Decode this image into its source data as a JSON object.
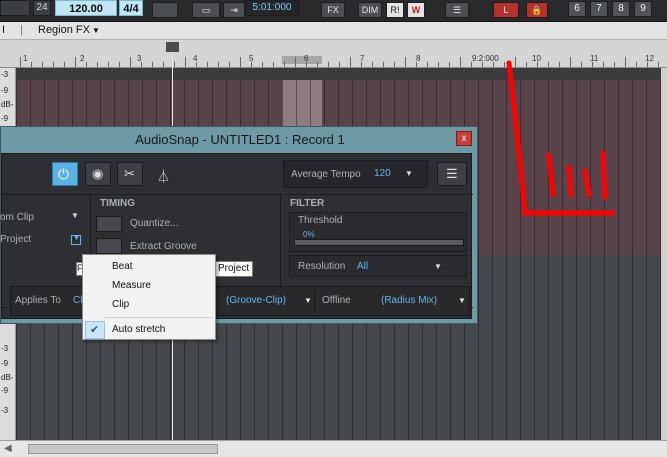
{
  "topbar": {
    "num_top": "24",
    "tempo": "120.00",
    "meter": "4/4",
    "time": "5:01:000",
    "fx": "FX",
    "dim": "DIM",
    "r": "R!",
    "w": "W",
    "lb": "L",
    "numbers": [
      "6",
      "7",
      "8",
      "9"
    ]
  },
  "menubar": {
    "item1": "I",
    "item2": "Region FX"
  },
  "ruler": {
    "marker": "9:2:000",
    "labels": [
      "1",
      "2",
      "3",
      "4",
      "5",
      "6",
      "7",
      "8",
      "10",
      "11",
      "12"
    ]
  },
  "left_strip": [
    "-3",
    "-9",
    "dB-",
    "-9",
    "-3",
    "-3",
    "-9",
    "dB-",
    "-9",
    "-3"
  ],
  "dialog": {
    "title": "AudioSnap - UNTITLED1 : Record 1",
    "close": "x",
    "avg_tempo_label": "Average Tempo",
    "avg_tempo_value": "120",
    "timing_header": "TIMING",
    "quantize": "Quantize...",
    "extract_groove": "Extract Groove",
    "filter_header": "FILTER",
    "threshold": "Threshold",
    "threshold_value": "0%",
    "resolution_label": "Resolution",
    "resolution_value": "All",
    "left_clip": "om Clip",
    "left_project": "Project",
    "applies_to": "Applies To",
    "applies_value": "Cli",
    "groove_clip": "(Groove-Clip)",
    "offline": "Offline",
    "radius_mix": "(Radius Mix)"
  },
  "tooltip": "Project",
  "tooltip_left": "F",
  "context_menu": {
    "items": [
      "Beat",
      "Measure",
      "Clip",
      "Auto stretch"
    ],
    "checked_item": "Auto stretch"
  },
  "colors": {
    "accent_blue": "#5fb7ea",
    "annotation_red": "#ff0000",
    "dialog_frame": "#6e9aa6",
    "track_red": "#58434a"
  }
}
